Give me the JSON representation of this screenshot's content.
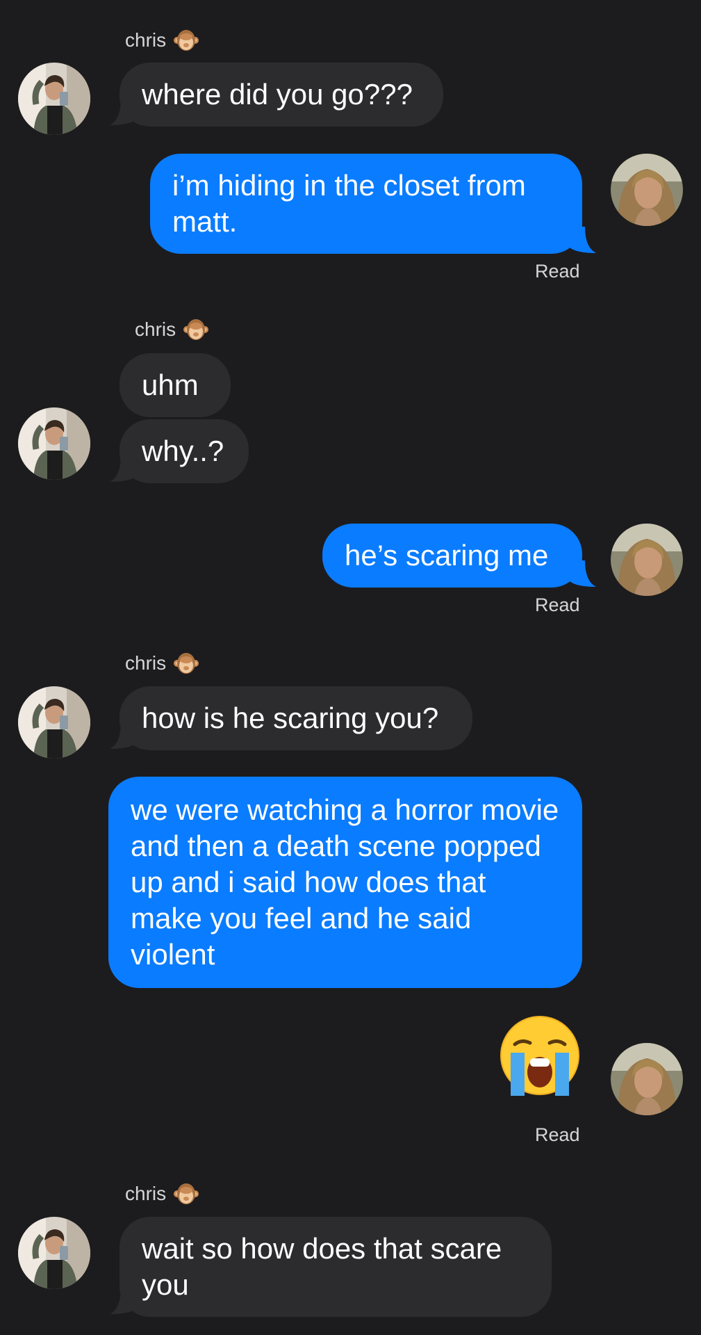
{
  "contact": {
    "name": "chris",
    "name_emoji_icon": "see-no-evil-monkey-icon"
  },
  "colors": {
    "background": "#1c1c1e",
    "incoming_bubble": "#2c2c2e",
    "outgoing_bubble": "#0a7cff",
    "meta_text": "#d6d6d8"
  },
  "messages": [
    {
      "sender": "chris",
      "text": "where did you go???"
    },
    {
      "sender": "me",
      "text": "i’m hiding in the closet from matt.",
      "receipt": "Read"
    },
    {
      "sender": "chris",
      "text": "uhm"
    },
    {
      "sender": "chris",
      "text": "why..?"
    },
    {
      "sender": "me",
      "text": "he’s scaring me",
      "receipt": "Read"
    },
    {
      "sender": "chris",
      "text": "how is he scaring you?"
    },
    {
      "sender": "me",
      "text": "we were watching a horror movie and then a death scene popped up and i said how does that make you feel and he said violent"
    },
    {
      "sender": "me",
      "emoji": "😭",
      "emoji_icon": "loudly-crying-face-icon",
      "receipt": "Read"
    },
    {
      "sender": "chris",
      "text": "wait so how does that scare you"
    }
  ]
}
